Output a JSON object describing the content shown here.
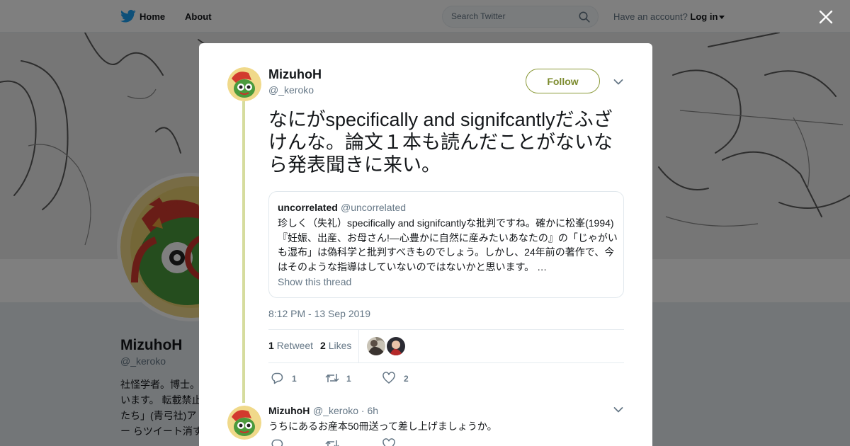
{
  "topbar": {
    "home_label": "Home",
    "about_label": "About",
    "search_placeholder": "Search Twitter",
    "account_prompt": "Have an account?",
    "login_label": "Log in"
  },
  "profile": {
    "name": "MizuhoH",
    "handle": "@_keroko",
    "bio": "社怪学者。博士。 います。 転載禁止 たち」(青弓社)アー らツイート消すっ"
  },
  "tweet": {
    "author_name": "MizuhoH",
    "author_handle": "@_keroko",
    "follow_label": "Follow",
    "text": "なにがspecifically and signifcantlyだふざけんな。論文１本も読んだことがないなら発表聞きに来い。",
    "timestamp": "8:12 PM - 13 Sep 2019",
    "retweet_count": "1",
    "retweet_label": "Retweet",
    "like_count": "2",
    "like_label": "Likes",
    "reply_action_count": "1",
    "retweet_action_count": "1",
    "like_action_count": "2"
  },
  "quote": {
    "name": "uncorrelated",
    "handle": "@uncorrelated",
    "text": "珍しく（失礼）specifically and signifcantlyな批判ですね。確かに松峯(1994)『妊娠、出産、お母さん!—心豊かに自然に産みたいあなたの』の「じゃがいも湿布」は偽科学と批判すべきものでしょう。しかし、24年前の著作で、今はそのような指導はしていないのではないかと思います。 …",
    "show_thread_label": "Show this thread"
  },
  "reply": {
    "author_name": "MizuhoH",
    "author_handle": "@_keroko",
    "time": "· 6h",
    "text": "うちにあるお産本50冊送って差し上げましょうか。"
  },
  "colors": {
    "accent": "#7c8b2e",
    "thread_line": "#d6dc9e",
    "muted": "#657786"
  }
}
